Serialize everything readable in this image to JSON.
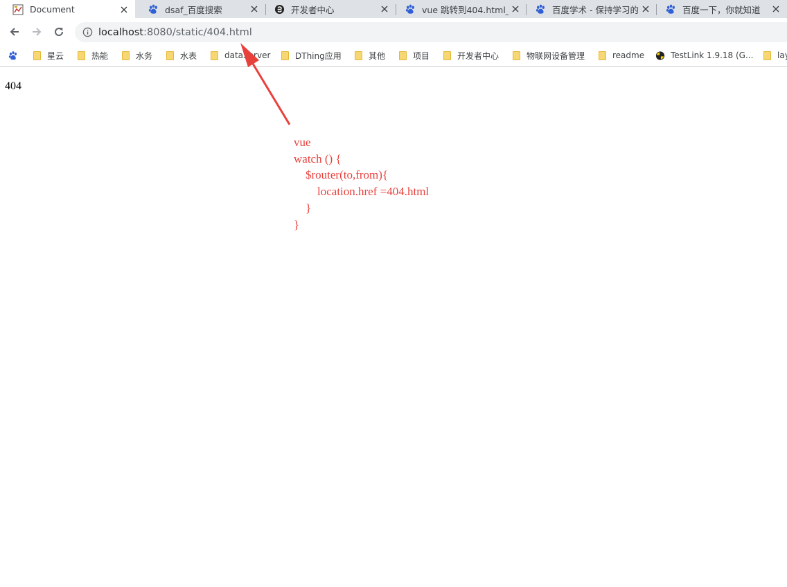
{
  "browser": {
    "tabs": [
      {
        "title": "Document",
        "icon": "document-favicon",
        "active": true
      },
      {
        "title": "dsaf_百度搜索",
        "icon": "baidu-paw-icon",
        "active": false
      },
      {
        "title": "开发者中心",
        "icon": "e-logo-icon",
        "active": false
      },
      {
        "title": "vue 跳转到404.html_百",
        "icon": "baidu-paw-icon",
        "active": false
      },
      {
        "title": "百度学术 - 保持学习的",
        "icon": "baidu-paw-icon",
        "active": false
      },
      {
        "title": "百度一下，你就知道",
        "icon": "baidu-paw-icon",
        "active": false
      }
    ],
    "address": {
      "host": "localhost",
      "path": ":8080/static/404.html"
    },
    "bookmarks": [
      {
        "label": "",
        "icon": "baidu-paw-icon"
      },
      {
        "label": "星云",
        "icon": "folder-icon"
      },
      {
        "label": "热能",
        "icon": "folder-icon"
      },
      {
        "label": "水务",
        "icon": "folder-icon"
      },
      {
        "label": "水表",
        "icon": "folder-icon"
      },
      {
        "label": "dataServer",
        "icon": "folder-icon"
      },
      {
        "label": "DThing应用",
        "icon": "folder-icon"
      },
      {
        "label": "其他",
        "icon": "folder-icon"
      },
      {
        "label": "项目",
        "icon": "folder-icon"
      },
      {
        "label": "开发者中心",
        "icon": "folder-icon"
      },
      {
        "label": "物联网设备管理",
        "icon": "folder-icon"
      },
      {
        "label": "readme",
        "icon": "folder-icon"
      },
      {
        "label": "TestLink 1.9.18 (G...",
        "icon": "testlink-icon"
      },
      {
        "label": "lay",
        "icon": "folder-icon"
      }
    ]
  },
  "page": {
    "text": "404"
  },
  "annotation": {
    "color": "#e8413c",
    "lines": [
      "vue",
      "watch () {",
      "    $router(to,from){",
      "        location.href =404.html",
      "    }",
      "}"
    ]
  }
}
